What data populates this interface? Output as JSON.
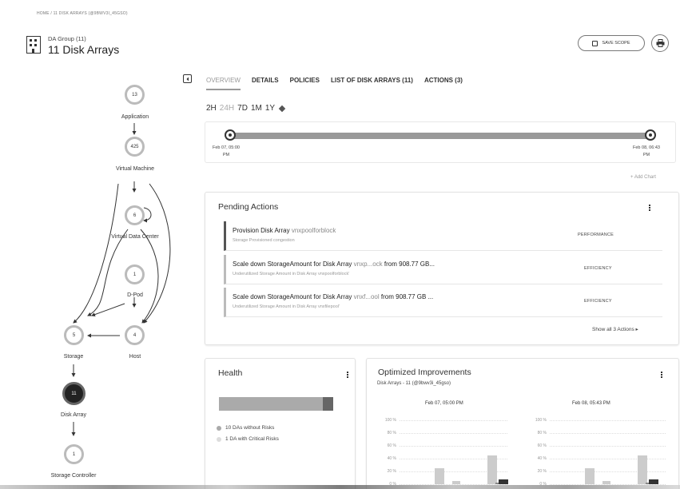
{
  "breadcrumb": "HOME / 11 DISK ARRAYS (@9BWV3I_45GSO)",
  "group": {
    "subtitle": "DA Group (11)",
    "title": "11 Disk Arrays"
  },
  "header_buttons": {
    "save_scope": "SAVE SCOPE"
  },
  "supply_chain": [
    {
      "id": "application",
      "count": "13",
      "label": "Application"
    },
    {
      "id": "virtual-machine",
      "count": "425",
      "label": "Virtual Machine"
    },
    {
      "id": "virtual-data-center",
      "count": "6",
      "label": "Virtual Data Center"
    },
    {
      "id": "d-pod",
      "count": "1",
      "label": "D-Pod"
    },
    {
      "id": "storage",
      "count": "5",
      "label": "Storage"
    },
    {
      "id": "host",
      "count": "4",
      "label": "Host"
    },
    {
      "id": "disk-array",
      "count": "11",
      "label": "Disk Array"
    },
    {
      "id": "storage-controller",
      "count": "1",
      "label": "Storage Controller"
    }
  ],
  "tabs": [
    "OVERVIEW",
    "DETAILS",
    "POLICIES",
    "LIST OF DISK ARRAYS (11)",
    "ACTIONS (3)"
  ],
  "time_ranges": [
    "2H",
    "24H",
    "7D",
    "1M",
    "1Y"
  ],
  "timeline": {
    "start": "Feb 07, 05:00",
    "start_suffix": "PM",
    "end": "Feb 08, 06:43",
    "end_suffix": "PM"
  },
  "add_chart": "+ Add Chart",
  "pending_actions": {
    "title": "Pending Actions",
    "items": [
      {
        "main": "Provision Disk Array",
        "target": "vnxpoolforblock",
        "tail": "",
        "sub": "Storage Provisioned congestion",
        "category": "PERFORMANCE"
      },
      {
        "main": "Scale down StorageAmount for Disk Array",
        "target": "vnxp...ock",
        "tail": "from 908.77 GB...",
        "sub": "Underutilized Storage Amount in Disk Array vnxpoolforblock'",
        "category": "EFFICIENCY"
      },
      {
        "main": "Scale down StorageAmount for Disk Array",
        "target": "vnxf...ool",
        "tail": "from 908.77 GB ...",
        "sub": "Underutilized Storage Amount in Disk Array vnxfilepool'",
        "category": "EFFICIENCY"
      }
    ],
    "show_all": "Show all 3 Actions ▸"
  },
  "health": {
    "title": "Health",
    "legend": [
      {
        "label": "10 DAs without Risks",
        "color": "#aaaaaa"
      },
      {
        "label": "1 DA with Critical Risks",
        "color": "#dddddd"
      }
    ],
    "without_risk_fraction": 0.91
  },
  "optimized": {
    "title": "Optimized Improvements",
    "subtitle": "Disk Arrays - 11 (@9bwv3i_45gso)",
    "chart_titles": [
      "Feb 07, 05:00 PM",
      "Feb 08, 05:43 PM"
    ],
    "y_ticks": [
      "100 %",
      "80 %",
      "60 %",
      "40 %",
      "20 %",
      "0 %"
    ]
  },
  "chart_data": [
    {
      "type": "bar",
      "title": "Feb 07, 05:00 PM",
      "ylim": [
        0,
        100
      ],
      "y_ticks": [
        "0 %",
        "20 %",
        "40 %",
        "60 %",
        "80 %",
        "100 %"
      ],
      "series": [
        {
          "values": [
            25,
            5,
            45,
            3,
            8
          ]
        }
      ]
    },
    {
      "type": "bar",
      "title": "Feb 08, 05:43 PM",
      "ylim": [
        0,
        100
      ],
      "y_ticks": [
        "0 %",
        "20 %",
        "40 %",
        "60 %",
        "80 %",
        "100 %"
      ],
      "series": [
        {
          "values": [
            25,
            5,
            45,
            3,
            8
          ]
        }
      ]
    }
  ],
  "colors": {
    "selected_node": "#222222",
    "node_ring": "#bbbbbb",
    "bar_dark": "#333333",
    "bar_light": "#cccccc"
  }
}
